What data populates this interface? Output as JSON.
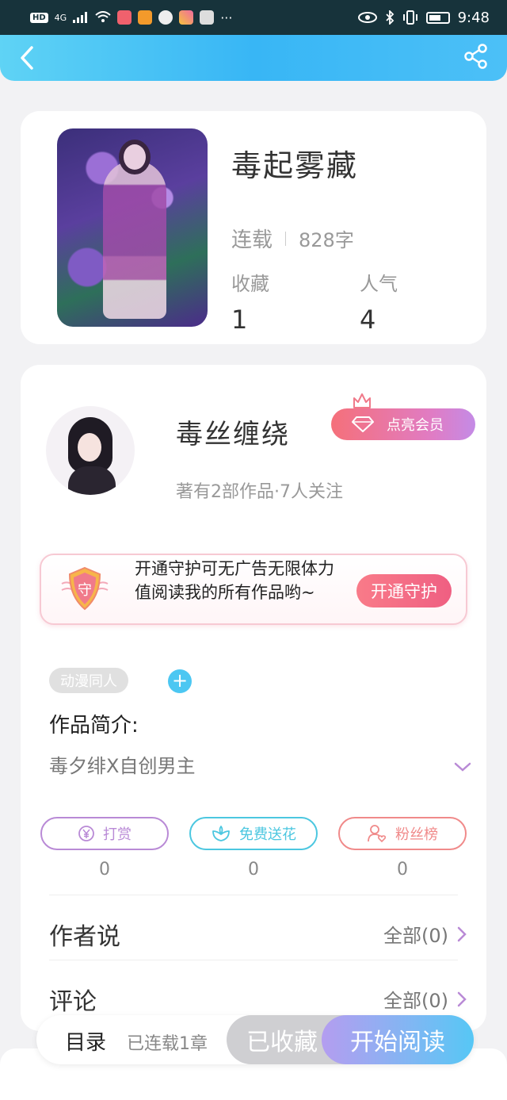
{
  "status_bar": {
    "badge": "HD",
    "network": "4G",
    "more": "···",
    "time": "9:48"
  },
  "book": {
    "title": "毒起雾藏",
    "status": "连载",
    "word_count": "828字",
    "stats": [
      {
        "label": "收藏",
        "value": "1"
      },
      {
        "label": "人气",
        "value": "4"
      }
    ]
  },
  "author": {
    "name": "毒丝缠绕",
    "meta": "著有2部作品·7人关注",
    "vip_label": "点亮会员"
  },
  "guard": {
    "shield_text": "守",
    "text": "开通守护可无广告无限体力值阅读我的所有作品哟~",
    "button": "开通守护"
  },
  "tags": [
    "动漫同人"
  ],
  "tag_add": "+",
  "intro": {
    "heading": "作品简介:",
    "text": "毒夕绯X自创男主"
  },
  "actions": [
    {
      "label": "打赏",
      "icon": "yen-coin-icon",
      "count": "0",
      "color": "#b98ad6"
    },
    {
      "label": "免费送花",
      "icon": "flower-icon",
      "count": "0",
      "color": "#4cc7e0"
    },
    {
      "label": "粉丝榜",
      "icon": "fan-person-icon",
      "count": "0",
      "color": "#f08a8a"
    }
  ],
  "sections": [
    {
      "title": "作者说",
      "link": "全部(0)"
    },
    {
      "title": "评论",
      "link": "全部(0)"
    }
  ],
  "bottom": {
    "toc": "目录",
    "serial": "已连载1章",
    "collected": "已收藏",
    "read": "开始阅读"
  },
  "colors": {
    "header": "#38b6f5",
    "accent_pink": "#ef5f82",
    "accent_purple": "#b98ad6"
  }
}
